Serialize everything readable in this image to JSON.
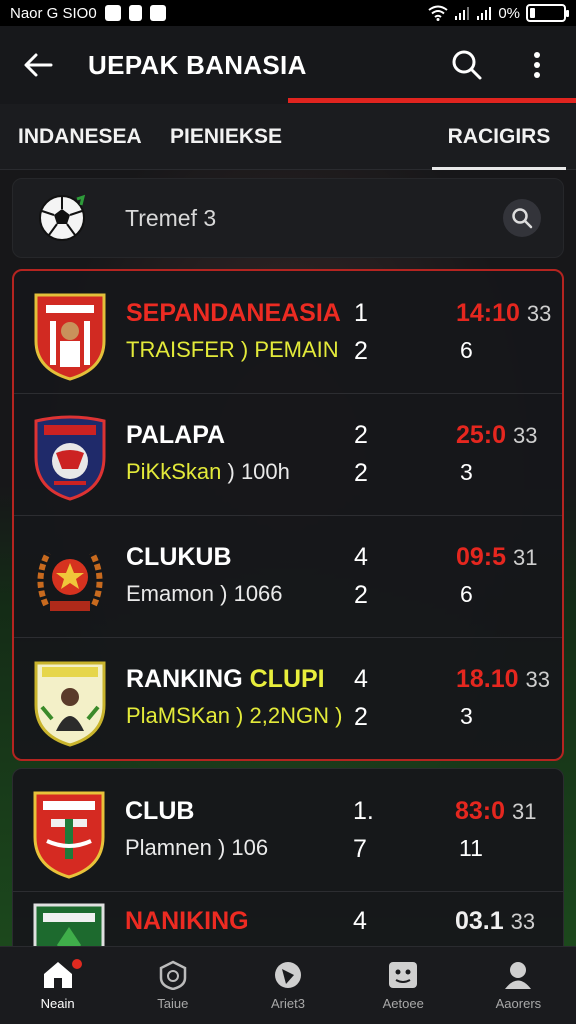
{
  "status_bar": {
    "carrier": "Naor G SIO0",
    "battery": "0%",
    "battery_level": 0.15
  },
  "app_bar": {
    "title": "UEPAK BANASIA"
  },
  "tabs": [
    {
      "label": "INDANESEA"
    },
    {
      "label": "PIENIEKSE"
    },
    {
      "label": "RACIGIRS",
      "selected": true
    }
  ],
  "search": {
    "text": "Tremef 3"
  },
  "teams": [
    {
      "name": "SEPANDANEASIA",
      "name_color": "red",
      "subtitle": "TRAISFER ) PEMAIN",
      "sub_color": "yellow",
      "n1": "1",
      "n2": "2",
      "time_main": "14:10",
      "time_extra": "33",
      "time_color": "red",
      "t2": "6",
      "crest_icon": "red-white-shield-crest-icon"
    },
    {
      "name": "PALAPA",
      "name_color": "white",
      "subtitle": "PiKkSkan )  100h",
      "sub_color": "mixed",
      "n1": "2",
      "n2": "2",
      "time_main": "25:0",
      "time_extra": "33",
      "time_color": "red",
      "t2": "3",
      "crest_icon": "navy-red-bull-crest-icon"
    },
    {
      "name": "CLUKUB",
      "name_color": "white",
      "subtitle": "Emamon )  1066",
      "sub_color": "white",
      "n1": "4",
      "n2": "2",
      "time_main": "09:5",
      "time_extra": "31",
      "time_color": "red",
      "t2": "6",
      "crest_icon": "laurel-wreath-crest-icon"
    },
    {
      "name_a": "RANKING",
      "name_b": "CLUPI",
      "name_color": "white-yellow",
      "subtitle": "PlaMSKan )  2,2NGN   )",
      "sub_color": "yellow",
      "n1": "4",
      "n2": "2",
      "time_main": "18.10",
      "time_extra": "33",
      "time_color": "red",
      "t2": "3",
      "crest_icon": "yellow-shield-player-crest-icon"
    }
  ],
  "teams_second": [
    {
      "name": "CLUB",
      "name_color": "white",
      "subtitle": "Plamnen )  106",
      "sub_color": "white",
      "n1": "1.",
      "n2": "7",
      "time_main": "83:0",
      "time_extra": "31",
      "time_color": "red",
      "t2": "11",
      "crest_icon": "red-green-shield-crest-icon"
    },
    {
      "name": "NANIKING",
      "name_color": "red",
      "subtitle": "",
      "n1": "4",
      "n2": "",
      "time_main": "03.1",
      "time_extra": "33",
      "time_color": "white",
      "t2": "",
      "crest_icon": "green-shield-crest-icon"
    }
  ],
  "bottom_nav": [
    {
      "label": "Neain",
      "icon": "home-icon",
      "active": true,
      "badge": true
    },
    {
      "label": "Taiue",
      "icon": "shield-badge-icon"
    },
    {
      "label": "Ariet3",
      "icon": "play-circle-icon"
    },
    {
      "label": "Aetoee",
      "icon": "face-icon"
    },
    {
      "label": "Aaorers",
      "icon": "profile-icon"
    }
  ],
  "colors": {
    "accent_red": "#e0241f",
    "highlight_yellow": "#e3ea3a",
    "background": "#0f1012"
  }
}
